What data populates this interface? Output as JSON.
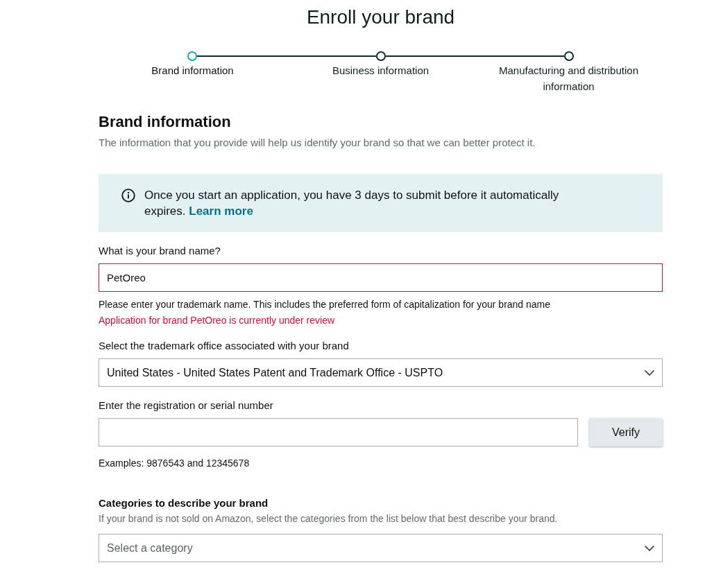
{
  "page": {
    "title": "Enroll your brand"
  },
  "steps": [
    {
      "label": "Brand information",
      "selected": true
    },
    {
      "label": "Business information",
      "selected": false
    },
    {
      "label": "Manufacturing and distribution information",
      "selected": false
    }
  ],
  "section": {
    "title": "Brand information",
    "description": "The information that you provide will help us identify your brand so that we can better protect it."
  },
  "notice": {
    "text": "Once you start an application, you have 3 days to submit before it automatically expires.",
    "link": "Learn more"
  },
  "fields": [
    {
      "kind": "text",
      "label": "What is your brand name?",
      "value": "PetOreo",
      "invalid": true,
      "hint": "Please enter your trademark name. This includes the preferred form of capitalization for your brand name",
      "error": "Application for brand PetOreo is currently under review"
    },
    {
      "kind": "select",
      "label": "Select the trademark office associated with your brand",
      "value": "United States - United States Patent and Trademark Office - USPTO"
    },
    {
      "kind": "text_button",
      "label": "Enter the registration or serial number",
      "invalid": false,
      "button": "Verify",
      "hint": "Examples: 9876543 and 12345678"
    }
  ],
  "categories": {
    "title": "Categories to describe your brand",
    "description": "If your brand is not sold on Amazon, select the categories from the list below that best describe your brand.",
    "select": {
      "placeholder": "Select a category"
    }
  }
}
